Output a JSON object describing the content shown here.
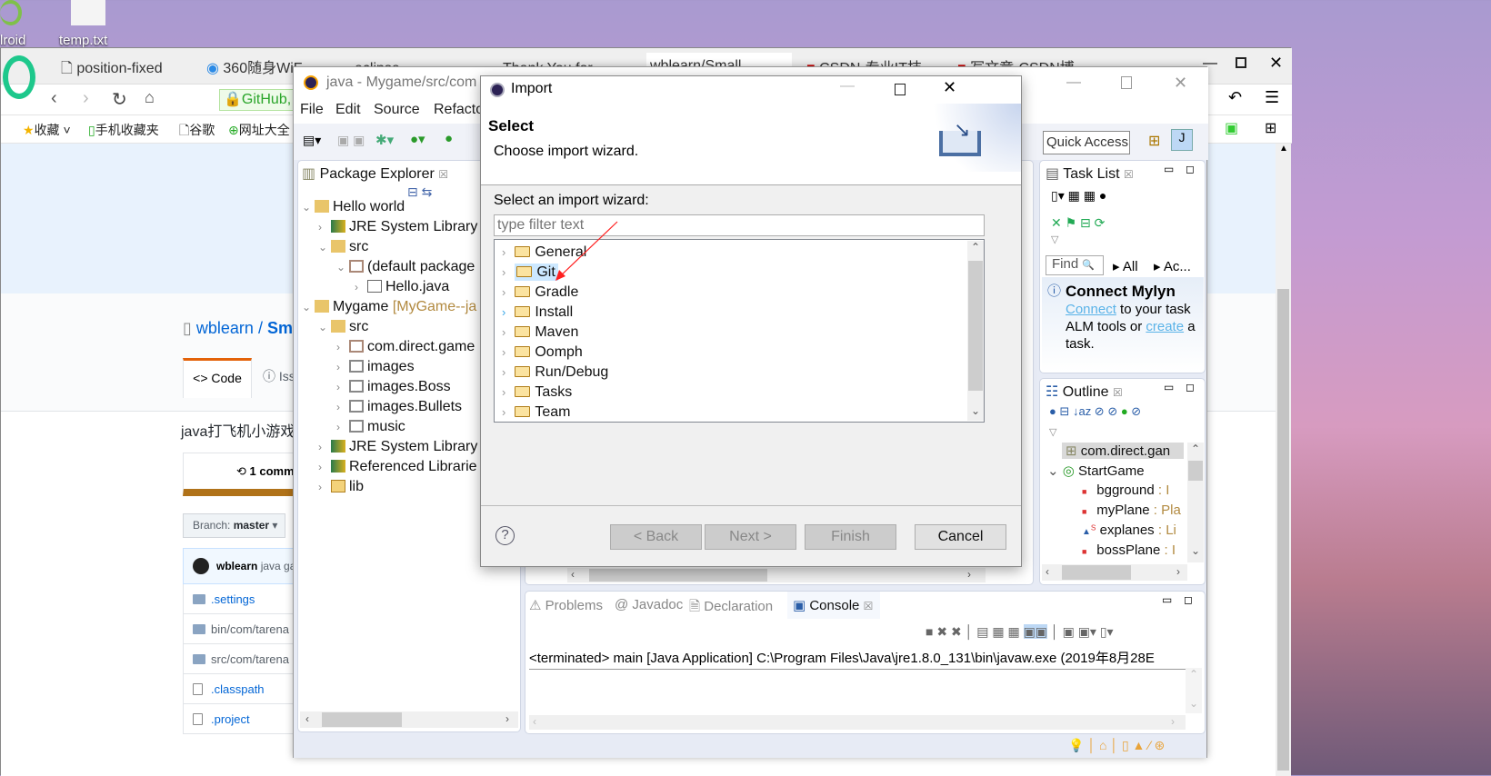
{
  "desktop": {
    "icons": [
      {
        "label": "lroid"
      },
      {
        "label": "temp.txt"
      }
    ]
  },
  "browser": {
    "tabs": [
      {
        "label": "position-fixed"
      },
      {
        "label": "360随身WiFi"
      },
      {
        "label": "eclipse...",
        "partial": true
      },
      {
        "label": "Thank You for..."
      },
      {
        "label": "wblearn/Small..."
      },
      {
        "label": "CSDN-专业IT技..."
      },
      {
        "label": "写文章-CSDN博..."
      }
    ],
    "address": "GitHub, I",
    "bookmarks": [
      {
        "label": "收藏"
      },
      {
        "label": "手机收藏夹"
      },
      {
        "label": "谷歌"
      },
      {
        "label": "网址大全"
      }
    ],
    "github": {
      "repo_owner": "wblearn",
      "repo_sep": "/",
      "repo_name": "Sm",
      "tabs": [
        {
          "label": "Code"
        },
        {
          "label": "Iss"
        }
      ],
      "description": "java打飞机小游戏",
      "commits": "1 comm",
      "branch_label": "Branch:",
      "branch": "master",
      "commit_author": "wblearn",
      "commit_msg": "java ga",
      "files": [
        {
          "name": ".settings",
          "type": "folder"
        },
        {
          "name": "bin/com/tarena",
          "type": "folder"
        },
        {
          "name": "src/com/tarena",
          "type": "folder"
        },
        {
          "name": ".classpath",
          "type": "file"
        },
        {
          "name": ".project",
          "type": "file"
        }
      ]
    }
  },
  "eclipse": {
    "title": "java - Mygame/src/com",
    "menu": [
      "File",
      "Edit",
      "Source",
      "Refacto"
    ],
    "quick_access": "Quick Access",
    "package_explorer": {
      "title": "Package Explorer",
      "tree": [
        {
          "label": "Hello world",
          "level": 0,
          "expanded": true
        },
        {
          "label": "JRE System Library",
          "level": 1
        },
        {
          "label": "src",
          "level": 1,
          "expanded": true
        },
        {
          "label": "(default package",
          "level": 2,
          "expanded": true
        },
        {
          "label": "Hello.java",
          "level": 3
        },
        {
          "label": "Mygame",
          "suffix": "[MyGame--ja",
          "level": 0,
          "expanded": true
        },
        {
          "label": "src",
          "level": 1,
          "expanded": true
        },
        {
          "label": "com.direct.game",
          "level": 2
        },
        {
          "label": "images",
          "level": 2
        },
        {
          "label": "images.Boss",
          "level": 2
        },
        {
          "label": "images.Bullets",
          "level": 2
        },
        {
          "label": "music",
          "level": 2
        },
        {
          "label": "JRE System Library",
          "level": 1
        },
        {
          "label": "Referenced Librarie",
          "level": 1
        },
        {
          "label": "lib",
          "level": 1
        }
      ]
    },
    "task_list": {
      "title": "Task List",
      "find": "Find",
      "all": "All",
      "ac": "Ac...",
      "mylyn_title": "Connect Mylyn",
      "mylyn_link1": "Connect",
      "mylyn_text1": " to your task",
      "mylyn_text2": "ALM tools or ",
      "mylyn_link2": "create",
      "mylyn_text3": " a",
      "mylyn_text4": "task."
    },
    "outline": {
      "title": "Outline",
      "items": [
        {
          "label": "com.direct.gan",
          "type": "package"
        },
        {
          "label": "StartGame",
          "type": "class"
        },
        {
          "label": "bgground",
          "suffix": " : I",
          "type": "field"
        },
        {
          "label": "myPlane",
          "suffix": " : Pla",
          "type": "field"
        },
        {
          "label": "explanes",
          "suffix": " : Li",
          "type": "static-field"
        },
        {
          "label": "bossPlane",
          "suffix": " : I",
          "type": "field"
        }
      ]
    },
    "bottom_tabs": [
      {
        "label": "Problems"
      },
      {
        "label": "Javadoc"
      },
      {
        "label": "Declaration"
      },
      {
        "label": "Console",
        "active": true
      }
    ],
    "console_line": "<terminated> main [Java Application] C:\\Program Files\\Java\\jre1.8.0_131\\bin\\javaw.exe (2019年8月28E"
  },
  "dialog": {
    "title": "Import",
    "heading": "Select",
    "subheading": "Choose import wizard.",
    "list_label": "Select an import wizard:",
    "filter_placeholder": "type filter text",
    "wizards": [
      {
        "label": "General"
      },
      {
        "label": "Git",
        "selected": true
      },
      {
        "label": "Gradle"
      },
      {
        "label": "Install"
      },
      {
        "label": "Maven"
      },
      {
        "label": "Oomph"
      },
      {
        "label": "Run/Debug"
      },
      {
        "label": "Tasks"
      },
      {
        "label": "Team"
      }
    ],
    "buttons": {
      "back": "< Back",
      "next": "Next >",
      "finish": "Finish",
      "cancel": "Cancel"
    },
    "annotation_color": "#ff2020"
  }
}
